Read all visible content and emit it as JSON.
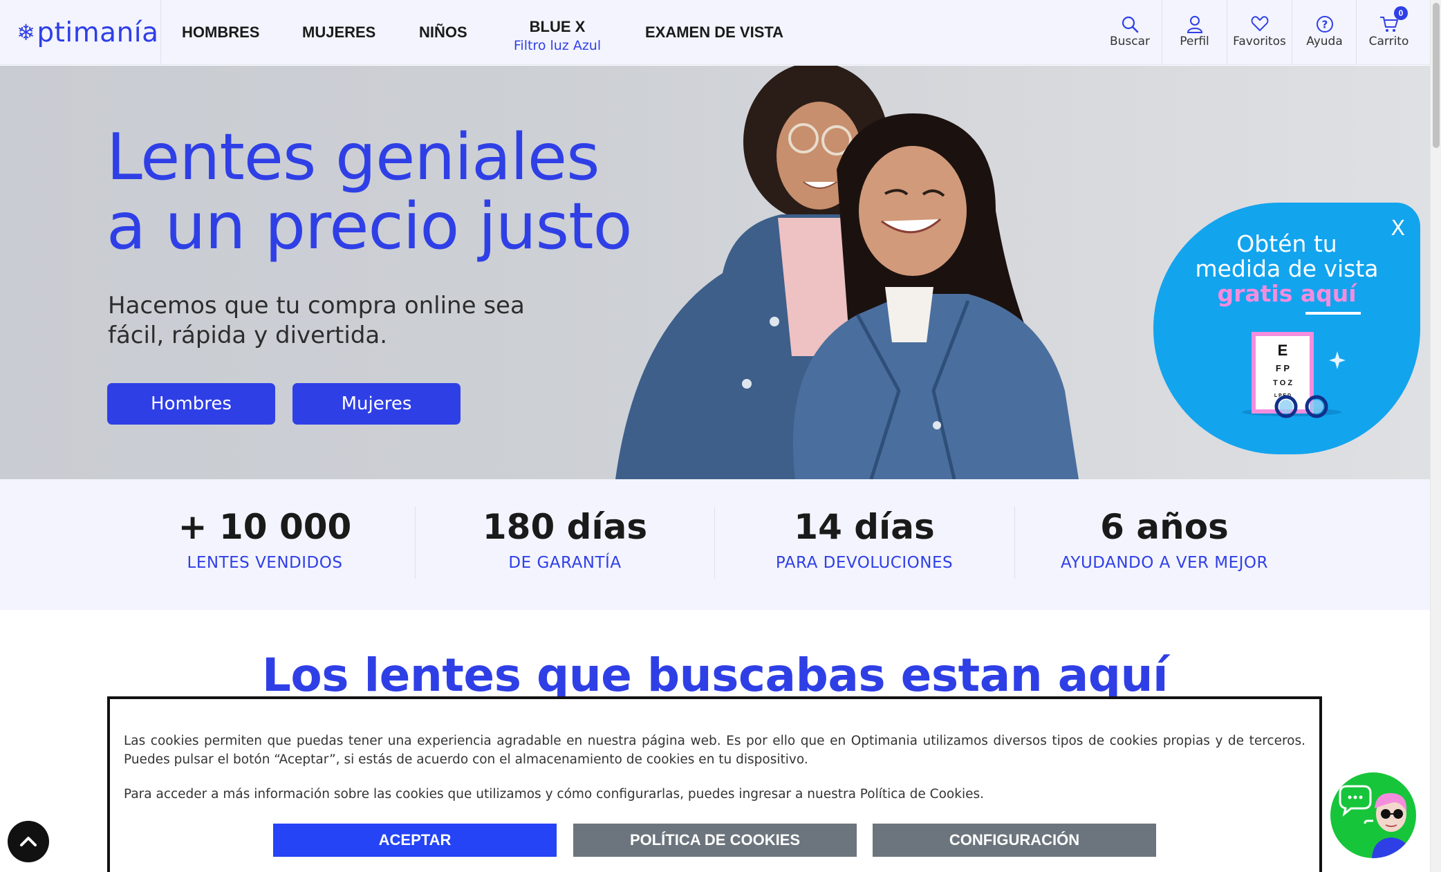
{
  "header": {
    "logo_text": "ptimanía",
    "nav": [
      {
        "label": "HOMBRES"
      },
      {
        "label": "MUJERES"
      },
      {
        "label": "NIÑOS"
      },
      {
        "label": "EXAMEN DE VISTA"
      }
    ],
    "bluex": {
      "title": "BLUE X",
      "subtitle": "Filtro luz Azul"
    },
    "tools": [
      {
        "label": "Buscar",
        "icon": "search-icon"
      },
      {
        "label": "Perfil",
        "icon": "user-icon"
      },
      {
        "label": "Favoritos",
        "icon": "heart-icon"
      },
      {
        "label": "Ayuda",
        "icon": "help-icon"
      },
      {
        "label": "Carrito",
        "icon": "cart-icon"
      }
    ],
    "cart_count": "0"
  },
  "hero": {
    "title_line1": "Lentes geniales",
    "title_line2": "a un precio justo",
    "sub_line1": "Hacemos que tu compra online sea",
    "sub_line2": "fácil, rápida y divertida.",
    "btn_men": "Hombres",
    "btn_women": "Mujeres"
  },
  "promo": {
    "close": "X",
    "line1": "Obtén tu",
    "line2": "medida de vista",
    "line3": "gratis aquí",
    "chart_letters": [
      "E",
      "F P",
      "T O Z",
      "L P E D"
    ]
  },
  "stats": [
    {
      "value": "+ 10 000",
      "label": "LENTES VENDIDOS"
    },
    {
      "value": "180 días",
      "label": "DE GARANTÍA"
    },
    {
      "value": "14 días",
      "label": "PARA DEVOLUCIONES"
    },
    {
      "value": "6 años",
      "label": "AYUDANDO A VER MEJOR"
    }
  ],
  "section_title": "Los lentes que buscabas estan aquí",
  "cookie": {
    "text1": "Las cookies permiten que puedas tener una experiencia agradable en nuestra página web. Es por ello que en Optimania utilizamos diversos tipos de cookies propias y de terceros. Puedes pulsar el botón “Aceptar”, si estás de acuerdo con el almacenamiento de cookies en tu dispositivo.",
    "text2": "Para acceder a más información sobre las cookies que utilizamos y cómo configurarlas, puedes ingresar a nuestra Política de Cookies.",
    "accept": "ACEPTAR",
    "policy": "POLÍTICA DE COOKIES",
    "config": "CONFIGURACIÓN"
  },
  "colors": {
    "brand_blue": "#2f3fe6",
    "promo_blue": "#13a4ee",
    "promo_pink": "#f48dde",
    "chat_green": "#17c53a",
    "cookie_grey": "#6c757d"
  }
}
